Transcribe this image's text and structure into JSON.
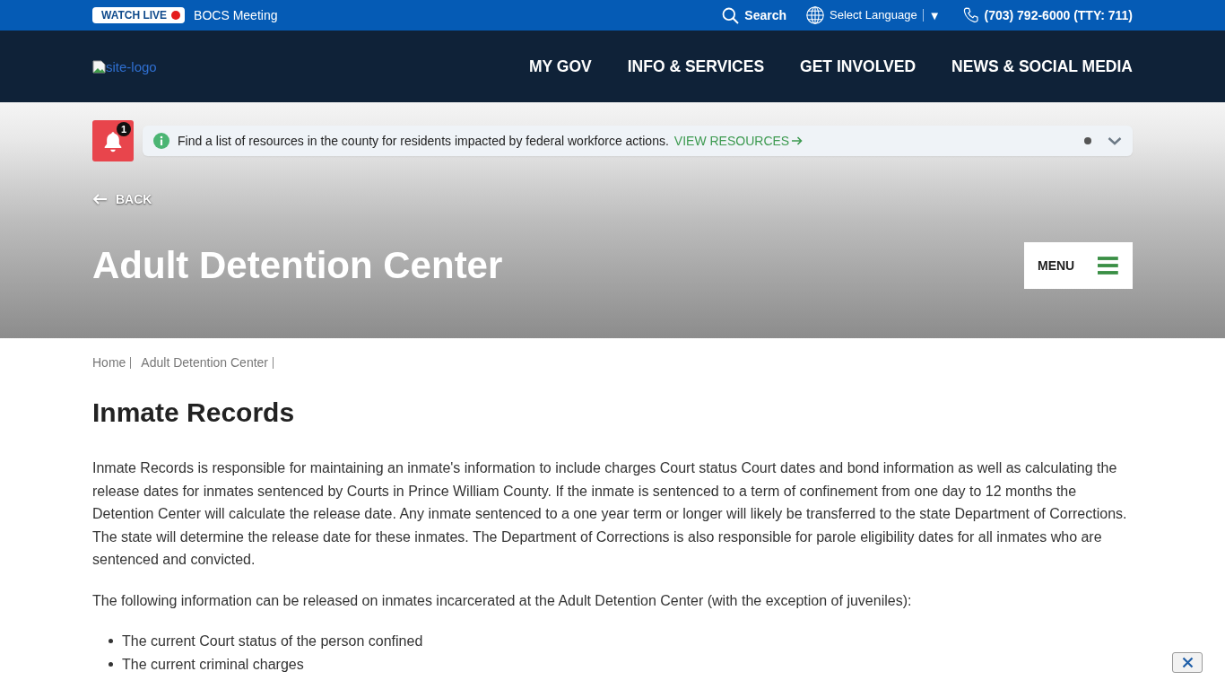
{
  "top_bar": {
    "watch_live": "WATCH LIVE",
    "meeting": "BOCS Meeting",
    "search": "Search",
    "language": "Select Language",
    "language_caret": "▼",
    "phone": "(703) 792-6000 (TTY: 711)"
  },
  "header": {
    "logo_alt": "site-logo",
    "nav": [
      "MY GOV",
      "INFO & SERVICES",
      "GET INVOLVED",
      "NEWS & SOCIAL MEDIA"
    ]
  },
  "alert": {
    "count": "1",
    "message": "Find a list of resources in the county for residents impacted by federal workforce actions.",
    "link": "VIEW RESOURCES"
  },
  "hero": {
    "back": "BACK",
    "title": "Adult Detention Center",
    "menu": "MENU"
  },
  "breadcrumbs": [
    "Home",
    "Adult Detention Center"
  ],
  "content": {
    "heading": "Inmate Records",
    "paragraphs": [
      "Inmate Records is responsible for maintaining an inmate's information to include charges Court status Court dates and bond information as well as calculating the release dates for inmates sentenced by Courts in Prince William County. If the inmate is sentenced to a term of confinement from one day to 12 months the Detention Center will calculate the release date. Any inmate sentenced to a one year term or longer will likely be transferred to the state Department of Corrections. The state will determine the release date for these inmates. The Department of Corrections is also responsible for parole eligibility dates for all inmates who are sentenced and convicted.",
      "The following information can be released on inmates incarcerated at the Adult Detention Center (with the exception of juveniles):"
    ],
    "bullets": [
      "The current Court status of the person confined",
      "The current criminal charges"
    ]
  }
}
